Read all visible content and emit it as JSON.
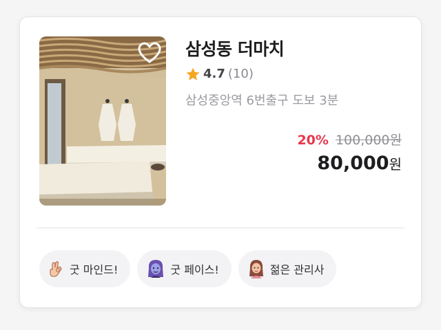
{
  "shop": {
    "name": "삼성동 더마치",
    "rating": "4.7",
    "review_count": "(10)",
    "location": "삼성중앙역 6번출구 도보 3분",
    "favorite_icon": "heart-outline-icon",
    "rating_icon": "star-icon"
  },
  "price": {
    "discount": "20%",
    "original": "100,000원",
    "final_amount": "80,000",
    "final_unit": "원"
  },
  "tags": [
    {
      "label": "굿 마인드!",
      "icon": "ok-hand-icon"
    },
    {
      "label": "굿 페이스!",
      "icon": "face-icon"
    },
    {
      "label": "젊은 관리사",
      "icon": "young-woman-icon"
    }
  ],
  "colors": {
    "discount": "#e8374b",
    "star": "#f5a623"
  }
}
